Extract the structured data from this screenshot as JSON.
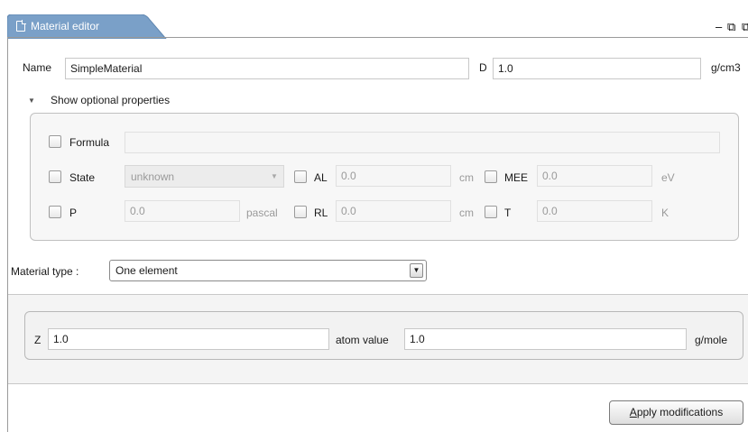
{
  "window": {
    "tab_title": "Material editor",
    "minimize_glyph": "–",
    "restore_glyph": "⧉"
  },
  "name_row": {
    "name_label": "Name",
    "name_value": "SimpleMaterial",
    "d_label": "D",
    "d_value": "1.0",
    "d_unit": "g/cm3"
  },
  "optional": {
    "toggle_label": "Show optional properties",
    "toggle_arrow": "▼",
    "formula": {
      "label": "Formula",
      "value": ""
    },
    "state": {
      "label": "State",
      "value": "unknown"
    },
    "al": {
      "label": "AL",
      "value": "0.0",
      "unit": "cm"
    },
    "mee": {
      "label": "MEE",
      "value": "0.0",
      "unit": "eV"
    },
    "p": {
      "label": "P",
      "value": "0.0",
      "unit": "pascal"
    },
    "rl": {
      "label": "RL",
      "value": "0.0",
      "unit": "cm"
    },
    "t": {
      "label": "T",
      "value": "0.0",
      "unit": "K"
    }
  },
  "material_type": {
    "label": "Material type :",
    "value": "One element",
    "arrow": "▼"
  },
  "element": {
    "z_label": "Z",
    "z_value": "1.0",
    "atom_value_label": "atom value",
    "atom_value": "1.0",
    "unit": "g/mole"
  },
  "actions": {
    "apply_mnemonic": "A",
    "apply_rest": "pply modifications"
  },
  "colors": {
    "tab_accent": "#7aa0c8",
    "frame": "#9a9a9a",
    "disabled_text": "#9a9a9a"
  }
}
